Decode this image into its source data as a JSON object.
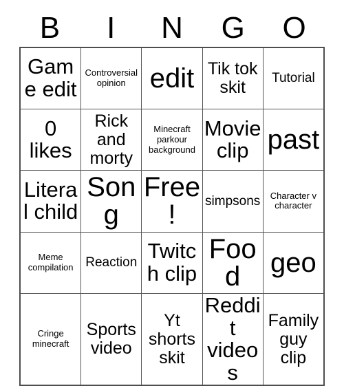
{
  "card": {
    "title": "BINGO",
    "header_letters": [
      "B",
      "I",
      "N",
      "G",
      "O"
    ],
    "free_space_label": "Free!",
    "rows": 5,
    "columns": 5,
    "border_color": "#555555",
    "text_color": "#000000",
    "background_color": "#ffffff",
    "cells": [
      [
        {
          "text": "Game edit",
          "size": "lg"
        },
        {
          "text": "Controversial opinion",
          "size": "xs"
        },
        {
          "text": "edit",
          "size": "xl"
        },
        {
          "text": "Tik tok skit",
          "size": "md"
        },
        {
          "text": "Tutorial",
          "size": "sm"
        }
      ],
      [
        {
          "text": "0 likes",
          "size": "lg"
        },
        {
          "text": "Rick and morty",
          "size": "md"
        },
        {
          "text": "Minecraft parkour background",
          "size": "xs"
        },
        {
          "text": "Movie clip",
          "size": "lg"
        },
        {
          "text": "past",
          "size": "xl"
        }
      ],
      [
        {
          "text": "Literal child",
          "size": "lg"
        },
        {
          "text": "Song",
          "size": "xl"
        },
        {
          "text": "Free!",
          "size": "xl"
        },
        {
          "text": "simpsons",
          "size": "sm"
        },
        {
          "text": "Character v character",
          "size": "xs"
        }
      ],
      [
        {
          "text": "Meme compilation",
          "size": "xs"
        },
        {
          "text": "Reaction",
          "size": "sm"
        },
        {
          "text": "Twitch clip",
          "size": "lg"
        },
        {
          "text": "Food",
          "size": "xl"
        },
        {
          "text": "geo",
          "size": "xl"
        }
      ],
      [
        {
          "text": "Cringe minecraft",
          "size": "xs"
        },
        {
          "text": "Sports video",
          "size": "md"
        },
        {
          "text": "Yt shorts skit",
          "size": "md"
        },
        {
          "text": "Reddit videos",
          "size": "lg"
        },
        {
          "text": "Family guy clip",
          "size": "md"
        }
      ]
    ]
  }
}
